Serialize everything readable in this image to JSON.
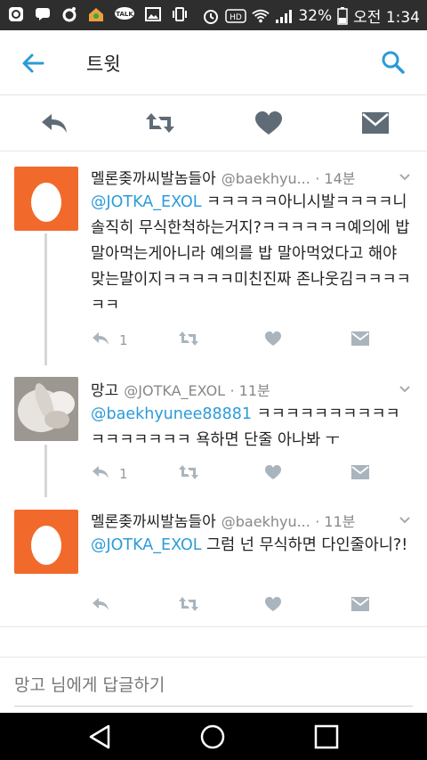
{
  "status_bar": {
    "battery": "32%",
    "time": "오전 1:34",
    "talk_label": "TALK",
    "hd_label": "HD",
    "icons": [
      "app-icon",
      "message-icon",
      "notification-icon",
      "home-app-icon",
      "kakaotalk-icon",
      "image-icon",
      "vibrate-icon",
      "alarm-icon",
      "hd-icon",
      "wifi-icon",
      "signal-icon",
      "battery-icon"
    ]
  },
  "header": {
    "title": "트윗"
  },
  "colors": {
    "accent": "#2b9bd8",
    "egg": "#f26a2b",
    "icon_gray": "#5f6b76"
  },
  "tweets": [
    {
      "name": "멜론좆까씨발놈들아",
      "handle": "@baekhyu...",
      "time": "· 14분",
      "mention": "@JOTKA_EXOL",
      "text": " ㅋㅋㅋㅋㅋ아니시발ㅋㅋㅋㅋ니솔직히 무식한척하는거지?ㅋㅋㅋㅋㅋㅋ예의에 밥말아먹는게아니라 예의를 밥 말아먹었다고 해야 맞는말이지ㅋㅋㅋㅋㅋ미친진짜 존나웃김ㅋㅋㅋㅋㅋㅋ",
      "reply_count": "1"
    },
    {
      "name": "망고",
      "handle": "@JOTKA_EXOL",
      "time": "· 11분",
      "mention": "@baekhyunee88881",
      "text": " ㅋㅋㅋㅋㅋㅋㅋㅋㅋㅋㅋㅋㅋㅋㅋㅋㅋ 욕하면 단줄 아나봐 ㅜ",
      "reply_count": "1"
    },
    {
      "name": "멜론좆까씨발놈들아",
      "handle": "@baekhyu...",
      "time": "· 11분",
      "mention": "@JOTKA_EXOL",
      "text": " 그럼 넌 무식하면 다인줄아니?!",
      "reply_count": ""
    }
  ],
  "reply_box": {
    "placeholder": "망고 님에게 답글하기"
  }
}
